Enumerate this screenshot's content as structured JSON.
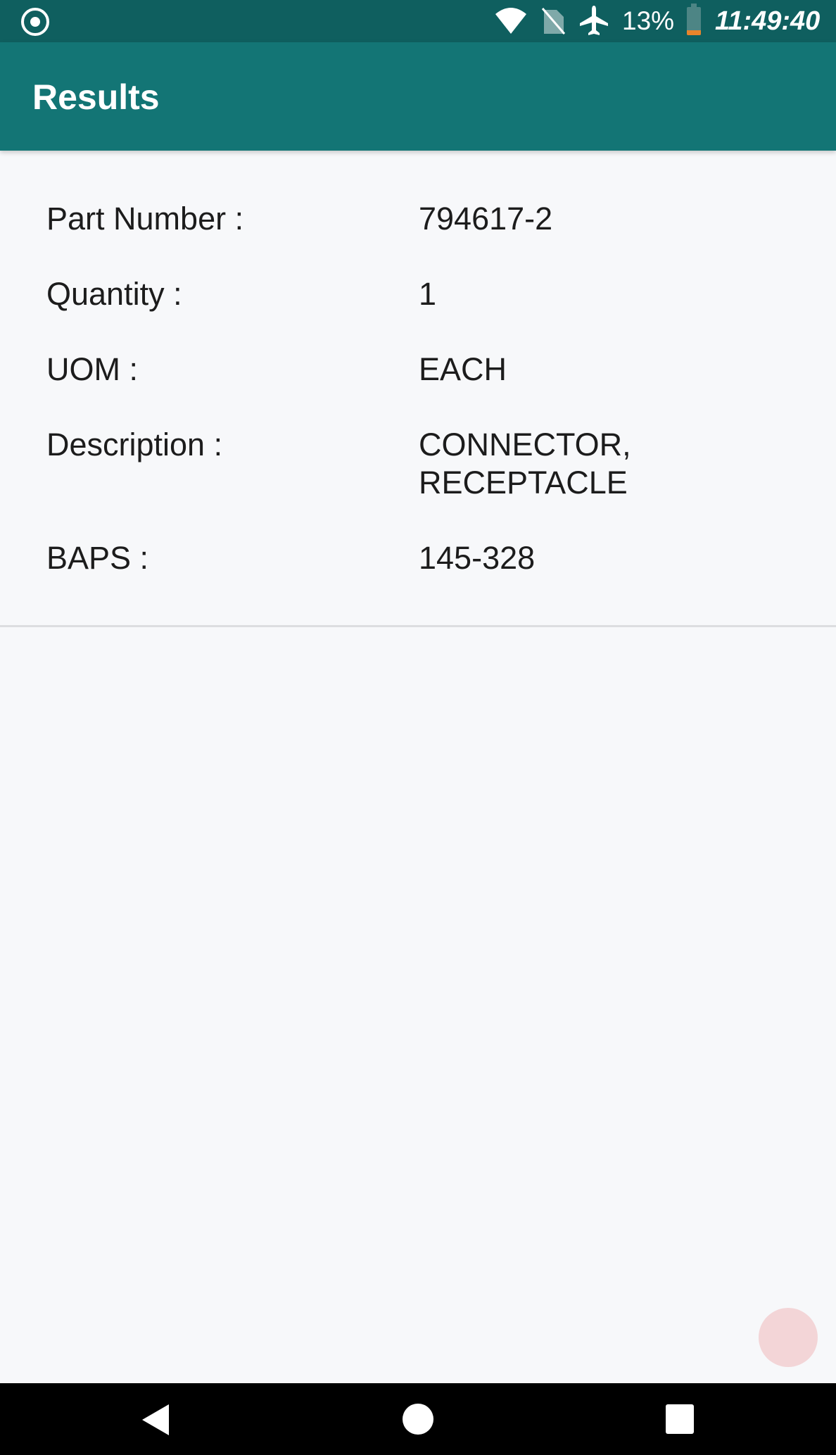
{
  "status_bar": {
    "battery_percent": "13%",
    "time": "11:49:40",
    "battery_level": 0.13,
    "icons": [
      "target-icon",
      "wifi-icon",
      "no-sim-icon",
      "airplane-mode-icon",
      "battery-icon"
    ]
  },
  "app_bar": {
    "title": "Results",
    "color": "#137575"
  },
  "details": [
    {
      "label": "Part Number :",
      "value": "794617-2"
    },
    {
      "label": "Quantity :",
      "value": "1"
    },
    {
      "label": "UOM :",
      "value": "EACH"
    },
    {
      "label": "Description :",
      "value_lines": [
        "CONNECTOR,",
        "RECEPTACLE"
      ]
    },
    {
      "label": "BAPS :",
      "value": "145-328"
    }
  ],
  "fab": {
    "icon": "circle-icon",
    "color": "#f3d5d7"
  },
  "nav_bar": {
    "icons": [
      "back-icon",
      "home-icon",
      "recents-icon"
    ]
  }
}
